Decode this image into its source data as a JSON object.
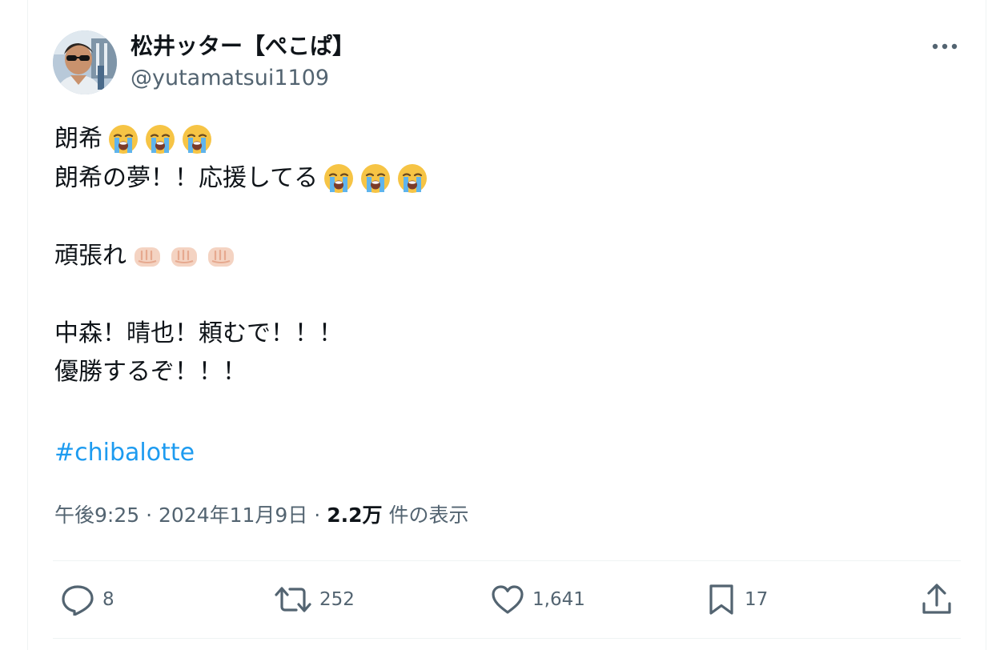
{
  "author": {
    "display_name": "松井ッター【ぺこぱ】",
    "handle": "@yutamatsui1109"
  },
  "tweet": {
    "lines": [
      {
        "text": "朗希",
        "emoji": [
          "loudly-crying-face",
          "loudly-crying-face",
          "loudly-crying-face"
        ]
      },
      {
        "text": "朗希の夢！！応援してる",
        "emoji": [
          "loudly-crying-face",
          "loudly-crying-face",
          "loudly-crying-face"
        ]
      },
      {
        "text": "",
        "emoji": []
      },
      {
        "text": "頑張れ",
        "emoji": [
          "oncoming-fist",
          "oncoming-fist",
          "oncoming-fist"
        ]
      },
      {
        "text": "",
        "emoji": []
      },
      {
        "text": "中森！晴也！頼むで！！！",
        "emoji": []
      },
      {
        "text": "優勝するぞ！！！",
        "emoji": []
      }
    ],
    "hashtag": "#chibalotte"
  },
  "meta": {
    "time": "午後9:25",
    "separator": "·",
    "date": "2024年11月9日",
    "views_count": "2.2万",
    "views_label": "件の表示"
  },
  "actions": {
    "replies": "8",
    "reposts": "252",
    "likes": "1,641",
    "bookmarks": "17"
  },
  "icons": {
    "more": "more-icon",
    "reply": "reply-icon",
    "repost": "repost-icon",
    "like": "heart-icon",
    "bookmark": "bookmark-icon",
    "share": "share-icon"
  },
  "colors": {
    "text": "#0f1419",
    "secondary": "#536471",
    "link": "#1d9bf0",
    "divider": "#eff3f4"
  }
}
